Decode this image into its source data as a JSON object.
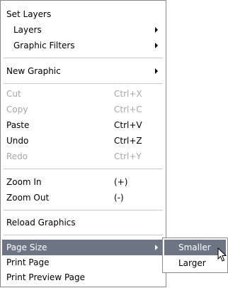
{
  "menu": {
    "set_layers": "Set Layers",
    "layers": "Layers",
    "graphic_filters": "Graphic Filters",
    "new_graphic": "New Graphic",
    "cut": "Cut",
    "cut_shortcut": "Ctrl+X",
    "copy": "Copy",
    "copy_shortcut": "Ctrl+C",
    "paste": "Paste",
    "paste_shortcut": "Ctrl+V",
    "undo": "Undo",
    "undo_shortcut": "Ctrl+Z",
    "redo": "Redo",
    "redo_shortcut": "Ctrl+Y",
    "zoom_in": "Zoom In",
    "zoom_in_shortcut": "(+)",
    "zoom_out": "Zoom Out",
    "zoom_out_shortcut": "(-)",
    "reload_graphics": "Reload Graphics",
    "page_size": "Page Size",
    "print_page": "Print Page",
    "print_preview_page": "Print Preview Page"
  },
  "submenu": {
    "smaller": "Smaller",
    "larger": "Larger"
  },
  "colors": {
    "highlight": "#6d7585",
    "disabled_text": "#a8a8a8",
    "border": "#8a8a8a"
  },
  "icons": {
    "submenu_arrow": "chevron-right-icon",
    "cursor": "mouse-pointer-icon"
  }
}
